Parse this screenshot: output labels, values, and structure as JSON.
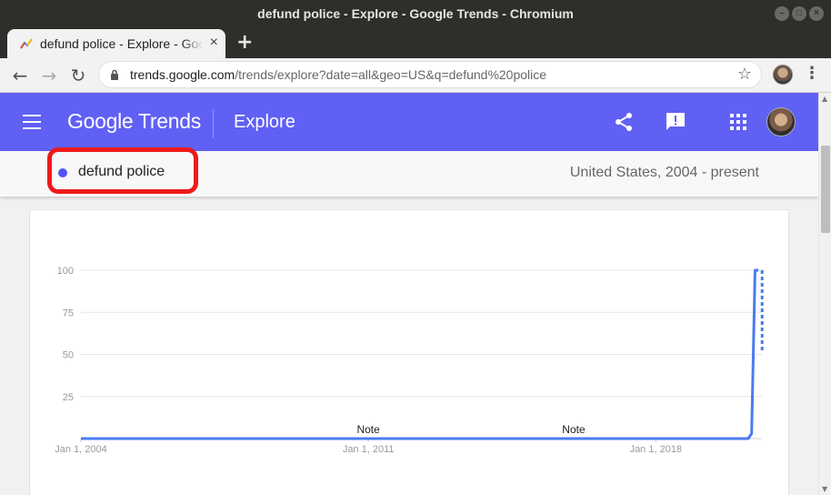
{
  "window": {
    "title": "defund police - Explore - Google Trends - Chromium"
  },
  "tab": {
    "title": "defund police - Explore - Google Trends",
    "close": "×"
  },
  "toolbar": {
    "url_host": "trends.google.com",
    "url_rest": "/trends/explore?date=all&geo=US&q=defund%20police"
  },
  "appbar": {
    "logo": "Google Trends",
    "section": "Explore",
    "icons": [
      "menu-icon",
      "share-icon",
      "feedback-icon",
      "apps-icon",
      "account-avatar"
    ]
  },
  "term": {
    "label": "defund police",
    "dot_color": "#4f54f5",
    "highlight_color": "#ee1a1a"
  },
  "region_range": "United States, 2004 - present",
  "colors": {
    "accent": "#6060f5",
    "line": "#4a7bf0"
  },
  "chart_data": {
    "type": "line",
    "series": [
      {
        "name": "defund police",
        "points": [
          {
            "x": "2004-01",
            "y": 0
          },
          {
            "x": "2020-04",
            "y": 0
          },
          {
            "x": "2020-05",
            "y": 3
          },
          {
            "x": "2020-06",
            "y": 100
          },
          {
            "x": "2020-07",
            "y": 100
          }
        ],
        "partial": {
          "x": "2020-07",
          "y": 51
        }
      }
    ],
    "ylim": [
      0,
      100
    ],
    "yticks": [
      "100",
      "75",
      "50",
      "25"
    ],
    "xticks": [
      "Jan 1, 2004",
      "Jan 1, 2011",
      "Jan 1, 2018"
    ],
    "annotations": [
      {
        "text": "Note",
        "x": "2011-01"
      },
      {
        "text": "Note",
        "x": "2016-01"
      }
    ],
    "grid": true,
    "xlabel": "",
    "ylabel": ""
  }
}
